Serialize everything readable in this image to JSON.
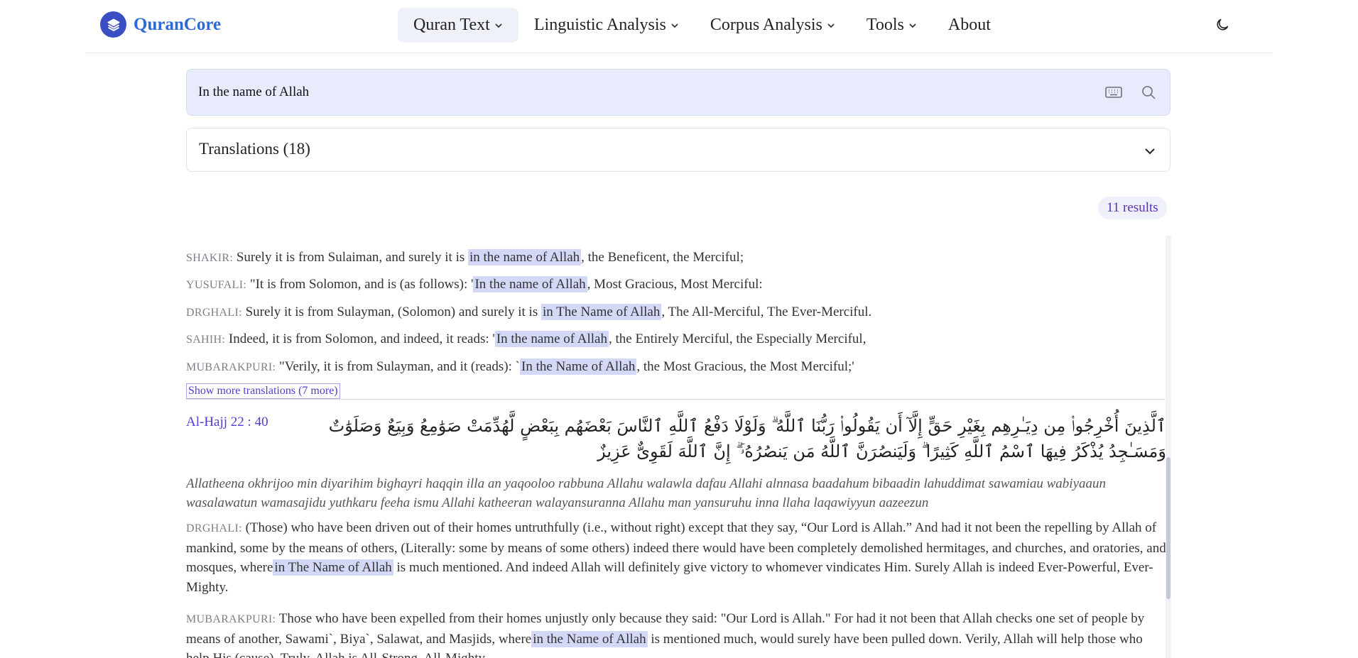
{
  "header": {
    "logo_text": "QuranCore",
    "nav": [
      {
        "label": "Quran Text",
        "dropdown": true,
        "active": true
      },
      {
        "label": "Linguistic Analysis",
        "dropdown": true
      },
      {
        "label": "Corpus Analysis",
        "dropdown": true
      },
      {
        "label": "Tools",
        "dropdown": true
      },
      {
        "label": "About",
        "dropdown": false
      }
    ],
    "theme_icon": "moon-icon"
  },
  "search": {
    "value": "In the name of Allah",
    "keyboard_icon": "keyboard-icon",
    "search_icon": "search-icon"
  },
  "translations_select": {
    "label": "Translations (18)"
  },
  "results_count": "11 results",
  "first_verse": {
    "lines": [
      {
        "source": "SHAKIR:",
        "before": "Surely it is from Sulaiman, and surely it is ",
        "highlight": "in the name of Allah",
        "after": ", the Beneficent, the Merciful;"
      },
      {
        "source": "YUSUFALI:",
        "before": "\"It is from Solomon, and is (as follows): '",
        "highlight": "In the name of Allah",
        "after": ", Most Gracious, Most Merciful:"
      },
      {
        "source": "DRGHALI:",
        "before": "Surely it is from Sulayman, (Solomon) and surely it is ",
        "highlight": "in The Name of Allah",
        "after": ", The All-Merciful, The Ever-Merciful."
      },
      {
        "source": "SAHIH:",
        "before": "Indeed, it is from Solomon, and indeed, it reads: '",
        "highlight": "In the name of Allah",
        "after": ", the Entirely Merciful, the Especially Merciful,"
      },
      {
        "source": "MUBARAKPURI:",
        "before": "\"Verily, it is from Sulayman, and it (reads): `",
        "highlight": "In the Name of Allah",
        "after": ", the Most Gracious, the Most Merciful;'"
      }
    ],
    "show_more": "Show more translations (7 more)"
  },
  "second_verse": {
    "reference": "Al-Hajj 22 : 40",
    "arabic": "ٱلَّذِينَ أُخْرِجُوا۟ مِن دِيَـٰرِهِم بِغَيْرِ حَقٍّ إِلَّآ أَن يَقُولُوا۟ رَبُّنَا ٱللَّهُ ۗ وَلَوْلَا دَفْعُ ٱللَّهِ ٱلنَّاسَ بَعْضَهُم بِبَعْضٍ لَّهُدِّمَتْ صَوَٰمِعُ وَبِيَعٌ وَصَلَوَٰتٌ وَمَسَـٰجِدُ يُذْكَرُ فِيهَا ٱسْمُ ٱللَّهِ كَثِيرًا ۗ وَلَيَنصُرَنَّ ٱللَّهُ مَن يَنصُرُهُۥٓ ۗ إِنَّ ٱللَّهَ لَقَوِىٌّ عَزِيزٌ",
    "transliteration": "Allatheena okhrijoo min diyarihim bighayri haqqin illa an yaqooloo rabbuna Allahu walawla dafau Allahi alnnasa baadahum bibaadin lahuddimat sawamiau wabiyaaun wasalawatun wamasajidu yuthkaru feeha ismu Allahi katheeran walayansuranna Allahu man yansuruhu inna llaha laqawiyyun aazeezun",
    "translations": [
      {
        "source": "DRGHALI:",
        "before": "(Those) who have been driven out of their homes untruthfully (i.e., without right) except that they say, “Our Lord is Allah.” And had it not been the repelling by Allah of mankind, some by the means of others, (Literally: some by means of some others) indeed there would have been completely demolished hermitages, and churches, and oratories, and mosques, where",
        "highlight": "in The Name of Allah",
        "after": " is much mentioned. And indeed Allah will definitely give victory to whomever vindicates Him. Surely Allah is indeed Ever-Powerful, Ever-Mighty."
      },
      {
        "source": "MUBARAKPURI:",
        "before": "Those who have been expelled from their homes unjustly only because they said: \"Our Lord is Allah.\" For had it not been that Allah checks one set of people by means of another, Sawami`, Biya`, Salawat, and Masjids, where",
        "highlight": "in the Name of Allah",
        "after": " is mentioned much, would surely have been pulled down. Verily, Allah will help those who help His (cause). Truly, Allah is All-Strong, All-Mighty."
      }
    ]
  },
  "colors": {
    "accent": "#4f3bd8",
    "highlight": "#d3d8f7",
    "logo": "#3a4ec4",
    "search_bg": "#e7ebfb"
  }
}
